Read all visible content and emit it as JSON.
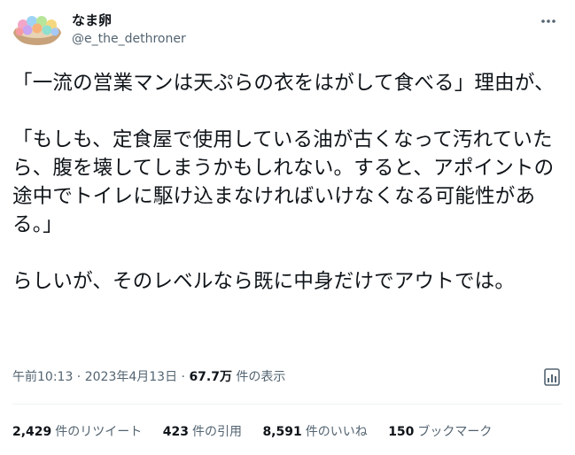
{
  "user": {
    "display_name": "なま卵",
    "handle": "@e_the_dethroner"
  },
  "tweet": {
    "paragraphs": [
      "「一流の営業マンは天ぷらの衣をはがして食べる」理由が、",
      "「もしも、定食屋で使用している油が古くなって汚れていたら、腹を壊してしまうかもしれない。すると、アポイントの途中でトイレに駆け込まなければいけなくなる可能性がある。」",
      "らしいが、そのレベルなら既に中身だけでアウトでは。"
    ]
  },
  "meta": {
    "time": "午前10:13",
    "separator1": " · ",
    "date": "2023年4月13日",
    "separator2": " · ",
    "views_count": "67.7万",
    "views_label": " 件の表示"
  },
  "stats": {
    "retweets": {
      "count": "2,429",
      "label": "件のリツイート"
    },
    "quotes": {
      "count": "423",
      "label": "件の引用"
    },
    "likes": {
      "count": "8,591",
      "label": "件のいいね"
    },
    "bookmarks": {
      "count": "150",
      "label": "ブックマーク"
    }
  },
  "icons": {
    "more": "more-icon",
    "analytics": "analytics-icon",
    "avatar": "avatar-image"
  }
}
